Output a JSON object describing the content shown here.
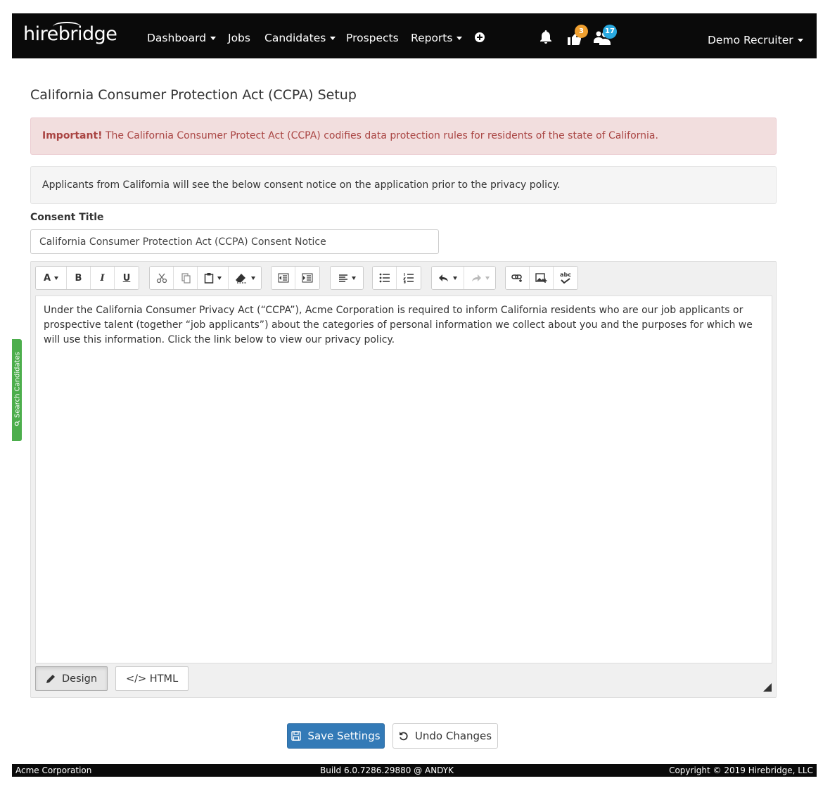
{
  "nav": {
    "logo": "hirebridge",
    "items": [
      {
        "label": "Dashboard",
        "dropdown": true
      },
      {
        "label": "Jobs",
        "dropdown": false
      },
      {
        "label": "Candidates",
        "dropdown": true
      },
      {
        "label": "Prospects",
        "dropdown": false
      },
      {
        "label": "Reports",
        "dropdown": true
      }
    ],
    "badges": {
      "tasks": "3",
      "people": "17"
    },
    "user": "Demo Recruiter"
  },
  "page": {
    "title": "California Consumer Protection Act (CCPA) Setup",
    "alert_strong": "Important!",
    "alert_text": " The California Consumer Protect Act (CCPA) codifies data protection rules for residents of the state of California.",
    "info_text": "Applicants from California will see the below consent notice on the application prior to the privacy policy."
  },
  "form": {
    "consent_title_label": "Consent Title",
    "consent_title_value": "California Consumer Protection Act (CCPA) Consent Notice"
  },
  "editor": {
    "content": "Under the California Consumer Privacy Act (“CCPA”), Acme Corporation is required to inform California residents who are our job applicants or prospective talent (together “job applicants”) about the categories of personal information we collect about you and the purposes for which we will use this information. Click the link below to view our privacy policy.",
    "toolbar": {
      "font_label": "A",
      "bold_label": "B",
      "italic_label": "I",
      "underline_label": "U",
      "spell_label": "abc"
    },
    "design_label": "Design",
    "html_label": "</> HTML"
  },
  "actions": {
    "save_label": "Save Settings",
    "undo_label": "Undo Changes"
  },
  "side_tab": {
    "label": "Search Candidates"
  },
  "footer": {
    "company": "Acme Corporation",
    "build": "Build 6.0.7286.29880 @ ANDYK",
    "copyright": "Copyright © 2019 Hirebridge, LLC"
  },
  "colors": {
    "navbar": "#0a0a0a",
    "primary": "#337ab7",
    "alert_text": "#a94442",
    "alert_bg": "#f2dede",
    "side_tab": "#4cae4c",
    "badge_orange": "#f0a030",
    "badge_blue": "#29a9e0"
  }
}
